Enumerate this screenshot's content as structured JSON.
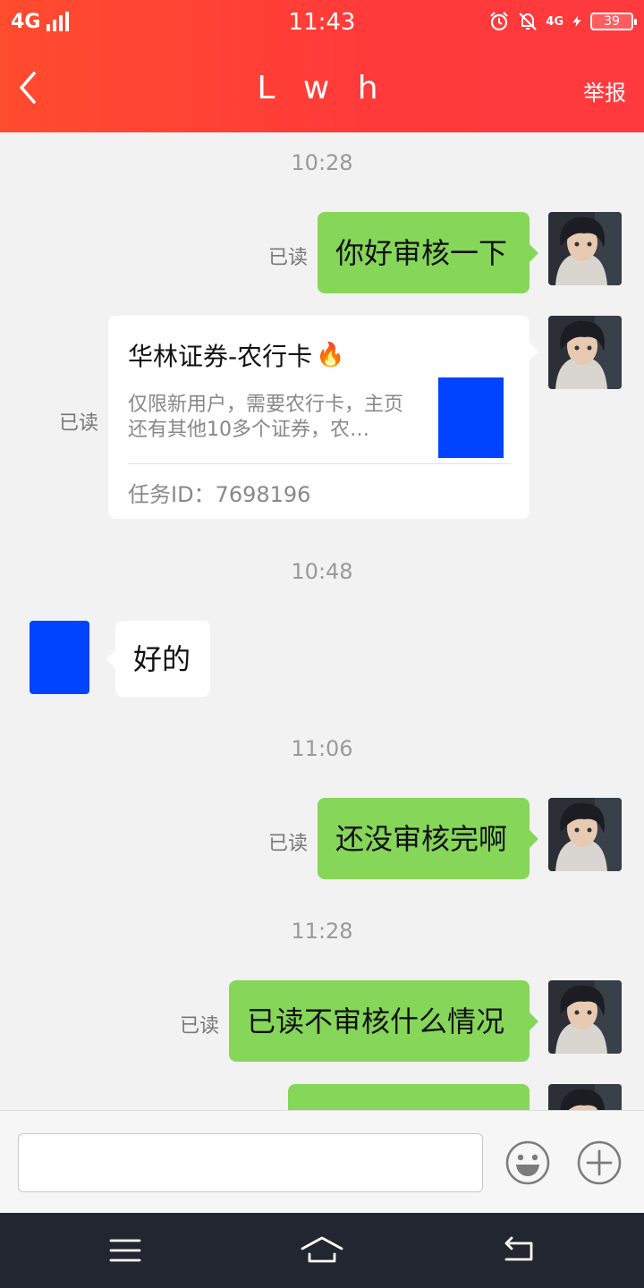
{
  "status_bar": {
    "network": "4G",
    "time": "11:43",
    "network_right": "4G",
    "battery": "39"
  },
  "header": {
    "title": "L w h",
    "report_label": "举报"
  },
  "chat": {
    "read_label": "已读",
    "timestamps": [
      "10:28",
      "10:48",
      "11:06",
      "11:28"
    ],
    "messages": [
      {
        "text": "你好审核一下"
      },
      {
        "text": "好的"
      },
      {
        "text": "还没审核完啊"
      },
      {
        "text": "已读不审核什么情况"
      }
    ],
    "card": {
      "title": "华林证券-农行卡",
      "title_icon": "fire-emoji",
      "emoji": "🔥",
      "description": "仅限新用户，需要农行卡，主页还有其他10多个证券，农…",
      "task_id": "任务ID：7698196"
    }
  },
  "input": {
    "placeholder": ""
  },
  "colors": {
    "header": "#ff3f34",
    "bubble_sent": "#86d65a",
    "bubble_received": "#ffffff",
    "background": "#f2f2f2",
    "nav_bar": "#222630",
    "placeholder_avatar": "#0044ff"
  }
}
